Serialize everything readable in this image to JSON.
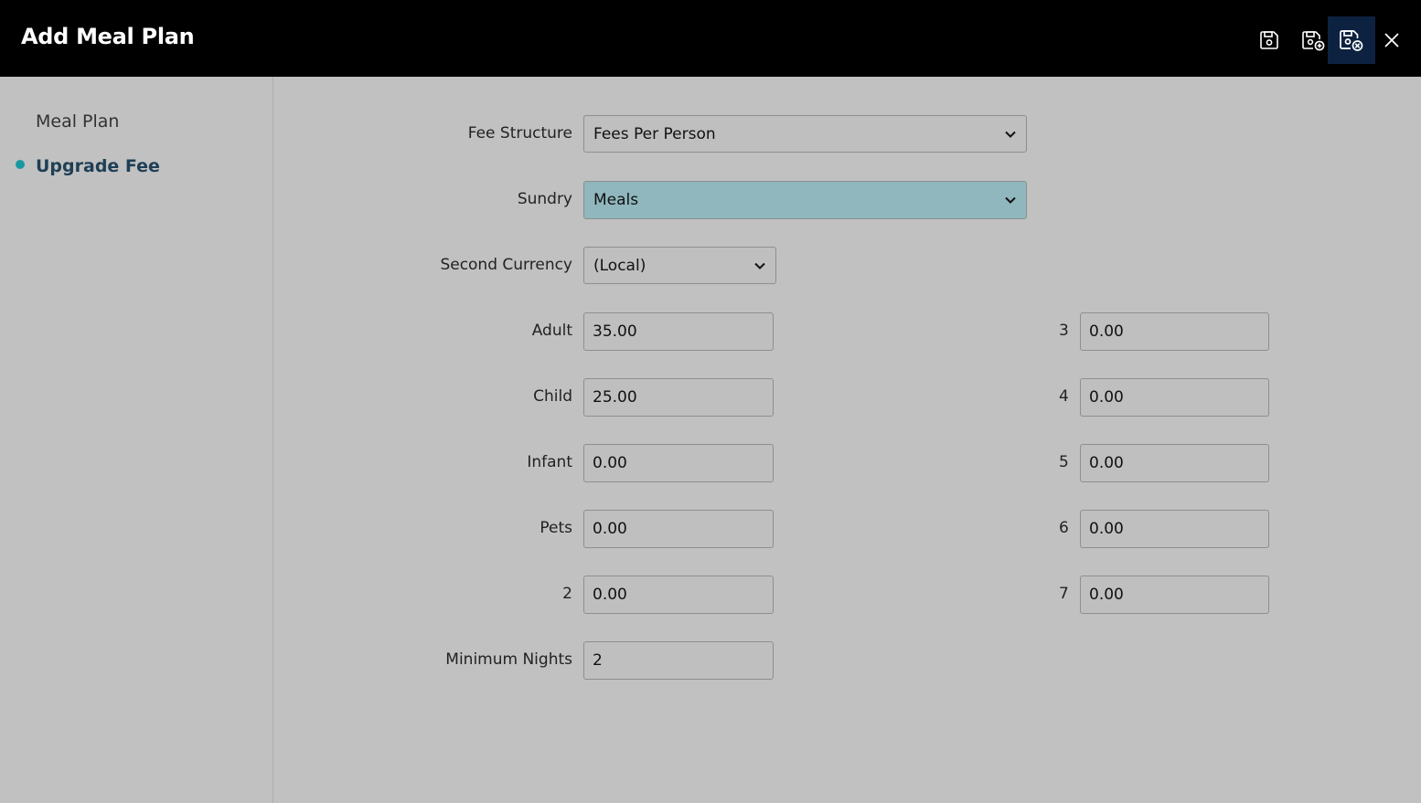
{
  "header": {
    "title": "Add Meal Plan",
    "buttons": [
      {
        "name": "save-icon"
      },
      {
        "name": "save-and-new-icon"
      },
      {
        "name": "save-and-close-icon"
      },
      {
        "name": "close-icon"
      }
    ]
  },
  "sidebar": {
    "items": [
      {
        "label": "Meal Plan",
        "active": false
      },
      {
        "label": "Upgrade Fee",
        "active": true
      }
    ],
    "active_color": "#1799a0"
  },
  "form": {
    "fee_structure": {
      "label": "Fee Structure",
      "value": "Fees Per Person"
    },
    "sundry": {
      "label": "Sundry",
      "value": "Meals"
    },
    "second_currency": {
      "label": "Second Currency",
      "value": "(Local)"
    },
    "adult": {
      "label": "Adult",
      "value": "35.00"
    },
    "child": {
      "label": "Child",
      "value": "25.00"
    },
    "infant": {
      "label": "Infant",
      "value": "0.00"
    },
    "pets": {
      "label": "Pets",
      "value": "0.00"
    },
    "extra_2": {
      "label": "2",
      "value": "0.00"
    },
    "extra_3": {
      "label": "3",
      "value": "0.00"
    },
    "extra_4": {
      "label": "4",
      "value": "0.00"
    },
    "extra_5": {
      "label": "5",
      "value": "0.00"
    },
    "extra_6": {
      "label": "6",
      "value": "0.00"
    },
    "extra_7": {
      "label": "7",
      "value": "0.00"
    },
    "minimum_nights": {
      "label": "Minimum Nights",
      "value": "2"
    }
  },
  "colors": {
    "header_bg": "#000000",
    "panel_bg": "#c1c1c1",
    "highlight_select": "#8fb7bd",
    "active_button_bg": "#0c2240"
  }
}
